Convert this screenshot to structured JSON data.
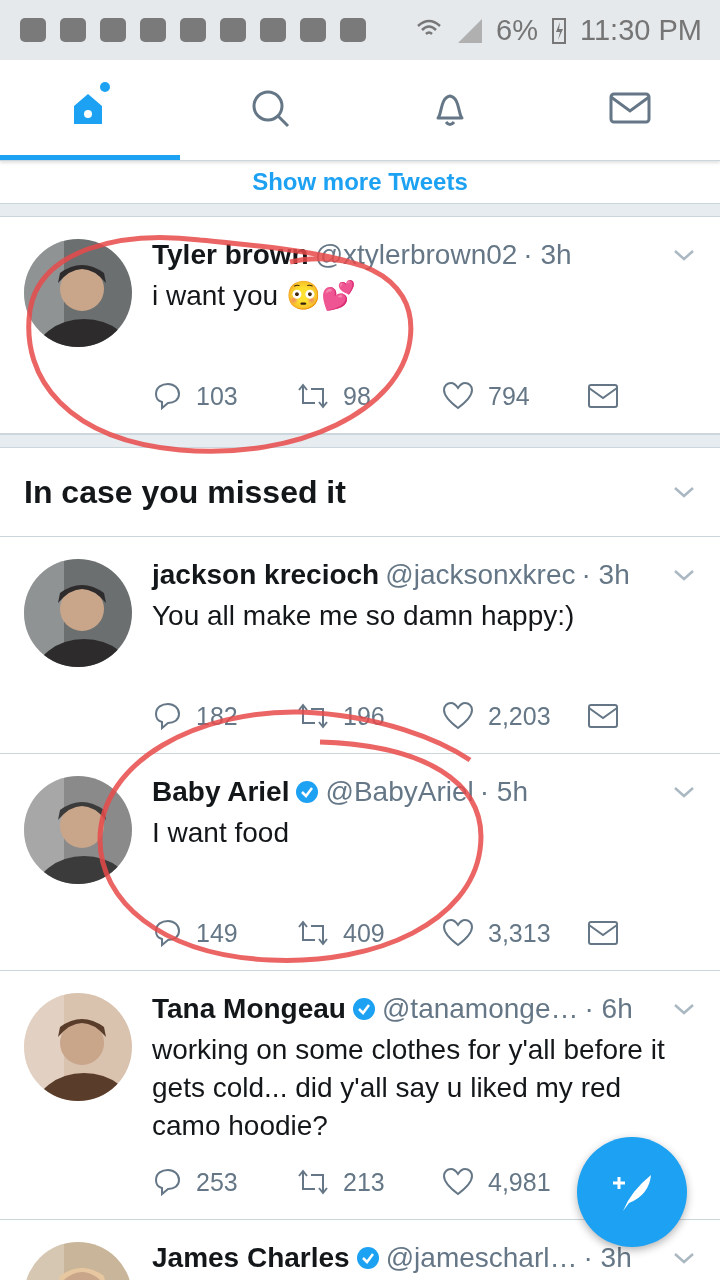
{
  "status_bar": {
    "battery": "6%",
    "time": "11:30 PM"
  },
  "tabs": [
    {
      "selected": true,
      "badge": true
    },
    {
      "selected": false,
      "badge": false
    },
    {
      "selected": false,
      "badge": false
    },
    {
      "selected": false,
      "badge": false
    }
  ],
  "show_more": "Show more Tweets",
  "top_tweets": [
    {
      "name": "Tyler brown",
      "verified": false,
      "handle": "@xtylerbrown02",
      "time": "· 3h",
      "text": "i want you 😳💕",
      "replies": "103",
      "retweets": "98",
      "likes": "794"
    }
  ],
  "section": {
    "title": "In case you missed it"
  },
  "tweets": [
    {
      "name": "jackson krecioch",
      "verified": false,
      "handle": "@jacksonxkrec",
      "time": "· 3h",
      "text": "You all make me so damn happy:)",
      "replies": "182",
      "retweets": "196",
      "likes": "2,203"
    },
    {
      "name": "Baby Ariel",
      "verified": true,
      "handle": "@BabyAriel",
      "time": "· 5h",
      "text": "I want food",
      "replies": "149",
      "retweets": "409",
      "likes": "3,313"
    },
    {
      "name": "Tana Mongeau",
      "verified": true,
      "handle": "@tanamonge…",
      "time": "· 6h",
      "text": "working on some clothes for y'all before it gets cold... did y'all say u liked my red camo hoodie?",
      "replies": "253",
      "retweets": "213",
      "likes": "4,981"
    },
    {
      "name": "James Charles",
      "verified": true,
      "handle": "@jamescharl…",
      "time": "· 3h"
    }
  ]
}
